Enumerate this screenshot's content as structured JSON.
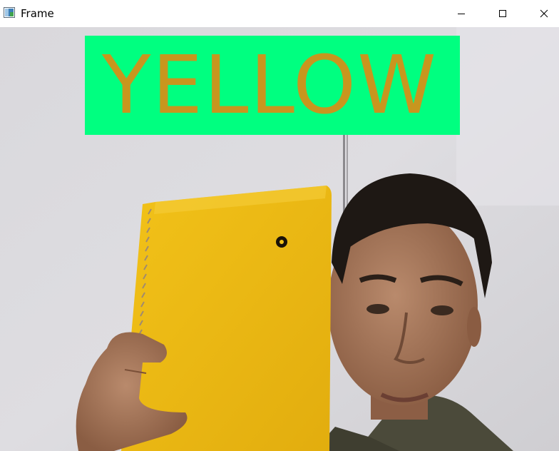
{
  "window": {
    "title": "Frame",
    "icon": "opencv-window-icon",
    "controls": {
      "minimize_icon": "minimize-icon",
      "maximize_icon": "maximize-icon",
      "close_icon": "close-icon"
    }
  },
  "overlay": {
    "label": "YELLOW",
    "background_color": "#00ff80",
    "text_color": "#c8961e"
  }
}
